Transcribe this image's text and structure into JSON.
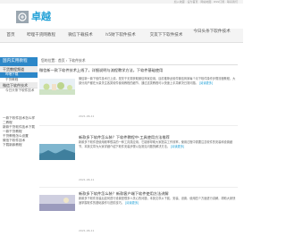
{
  "top_strip": "加入收藏 · 设为首页 · 网站地图 · RSS订阅 · 联系我们",
  "site": {
    "logo_text": "卓越"
  },
  "nav": [
    {
      "label": "首页"
    },
    {
      "label": "哔哩干货网教程"
    },
    {
      "label": "微信下载技术"
    },
    {
      "label": "h5财下软件技术"
    },
    {
      "label": "交友下下软件技术"
    },
    {
      "label": "今日头条下软件技术"
    }
  ],
  "sidebar": {
    "header": "国内实用教程",
    "group_title": "干货教程频道",
    "group_items": [
      "哔哩下载",
      "干货教程"
    ],
    "section2_title": "微信下软件技术",
    "section2_items": [
      "今日头条下软件技术"
    ],
    "list_items": [
      "一款下软件技术怎么样",
      "二教程",
      "新款干货软件技术下载",
      "一款干货教程",
      "干货教程怎么设置",
      "微信下软件技术",
      "下载新款教程"
    ]
  },
  "main": {
    "breadcrumb": "您的位置：首页 › 下软件技术",
    "articles": [
      {
        "title": "微信新一款下软件技术上线了，详细说明与流程教学方法，下软件基础使用",
        "body": "微信新一款下软件技术已上线，是关于无需获取微信商家应用，目前推荐此软件微信商家每个月下软件操作步骤流程教程，大部分用户都在大量关注各类软件使用教程的细节，通过这类教程可以快速上手并解决日常问题。",
        "more": "[阅读更多]",
        "date": "2021-06-11"
      },
      {
        "title": "新款多下软件怎么装？下软件教程中·工具使用方法推荐",
        "body": "新款多下软件是使用频率很高的一种工具类应用，它能够帮助大家提高工作效率，使用过程中需要注意软件的安装和设置细节，本篇文章为大家详细介绍下软件安装步骤以及常见问题的解决方法。",
        "more": "[阅读更多]",
        "date": "2021-06-11"
      },
      {
        "title": "新款多下软件怎么装？新款客户端下软件使用方法讲解",
        "body": "新款多下软件安装后如何进行设置是很多人关心的问题，本篇文章从下载、安装、设置、使用四个方面进行讲解，帮助大家快速掌握软件的基础操作与进阶技巧。",
        "more": "[阅读更多]",
        "date": "2021-06-11"
      }
    ]
  },
  "colors": {
    "accent": "#2c87c8",
    "link": "#1e9fd6"
  }
}
